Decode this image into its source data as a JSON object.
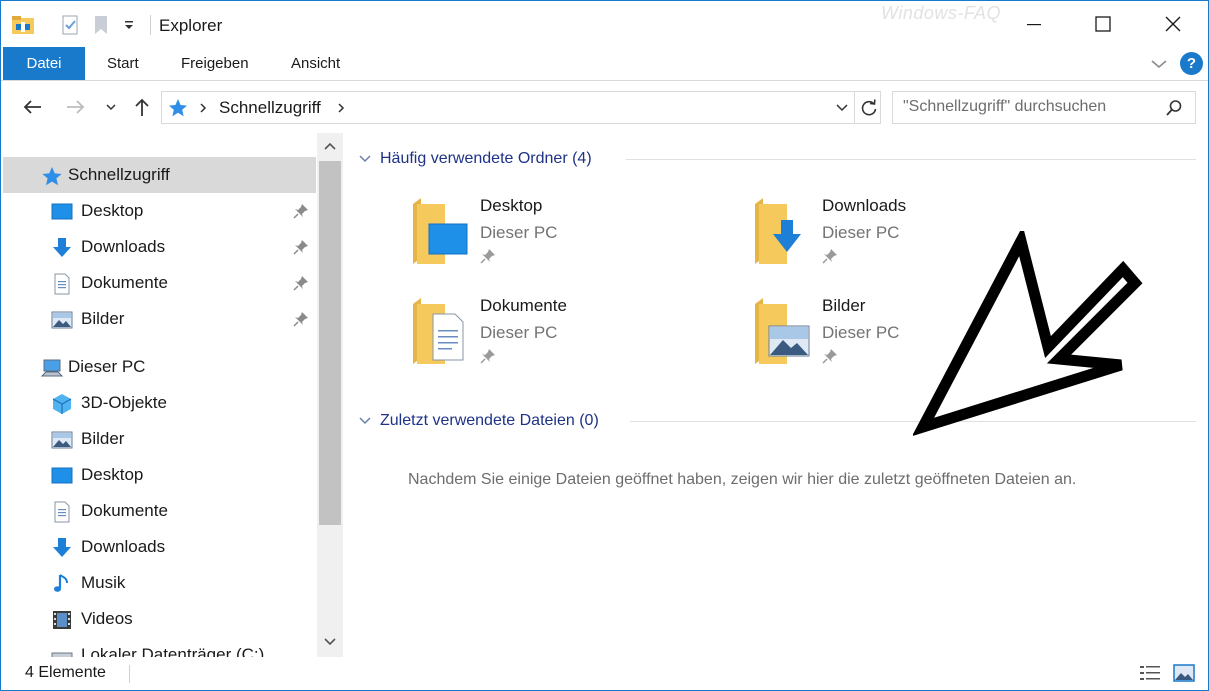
{
  "window": {
    "title": "Explorer",
    "watermark": "Windows-FAQ"
  },
  "ribbon": {
    "tabs": [
      {
        "label": "Datei",
        "active": true
      },
      {
        "label": "Start"
      },
      {
        "label": "Freigeben"
      },
      {
        "label": "Ansicht"
      }
    ],
    "help_label": "?"
  },
  "navigation": {
    "address_location": "Schnellzugriff",
    "search_placeholder": "\"Schnellzugriff\" durchsuchen"
  },
  "sidebar": {
    "quick_access": {
      "label": "Schnellzugriff",
      "items": [
        {
          "label": "Desktop",
          "icon": "desktop-icon",
          "pinned": true
        },
        {
          "label": "Downloads",
          "icon": "downloads-icon",
          "pinned": true
        },
        {
          "label": "Dokumente",
          "icon": "documents-icon",
          "pinned": true
        },
        {
          "label": "Bilder",
          "icon": "pictures-icon",
          "pinned": true
        }
      ]
    },
    "this_pc": {
      "label": "Dieser PC",
      "items": [
        {
          "label": "3D-Objekte",
          "icon": "3d-objects-icon"
        },
        {
          "label": "Bilder",
          "icon": "pictures-icon"
        },
        {
          "label": "Desktop",
          "icon": "desktop-icon"
        },
        {
          "label": "Dokumente",
          "icon": "documents-icon"
        },
        {
          "label": "Downloads",
          "icon": "downloads-icon"
        },
        {
          "label": "Musik",
          "icon": "music-icon"
        },
        {
          "label": "Videos",
          "icon": "videos-icon"
        },
        {
          "label": "Lokaler Datenträger (C:)",
          "icon": "drive-icon"
        }
      ]
    }
  },
  "content": {
    "frequent_folders": {
      "title": "Häufig verwendete Ordner (4)",
      "items": [
        {
          "name": "Desktop",
          "location": "Dieser PC"
        },
        {
          "name": "Downloads",
          "location": "Dieser PC"
        },
        {
          "name": "Dokumente",
          "location": "Dieser PC"
        },
        {
          "name": "Bilder",
          "location": "Dieser PC"
        }
      ]
    },
    "recent_files": {
      "title": "Zuletzt verwendete Dateien (0)",
      "empty_message": "Nachdem Sie einige Dateien geöffnet haben, zeigen wir hier die zuletzt geöffneten Dateien an."
    }
  },
  "status": {
    "item_count": "4 Elemente"
  },
  "colors": {
    "accent": "#1979ca",
    "group_title": "#1e3287",
    "folder": "#f5c95b",
    "selection": "#d9d9d9"
  }
}
